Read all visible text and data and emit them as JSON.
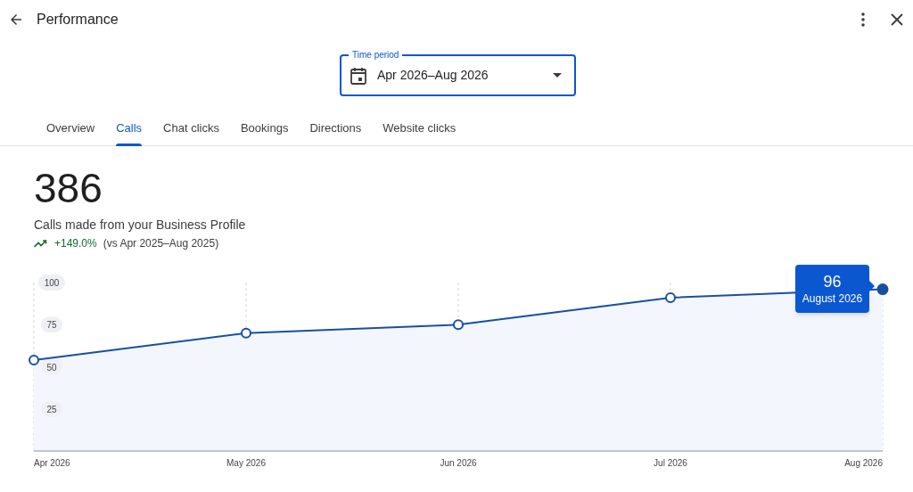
{
  "header": {
    "title": "Performance"
  },
  "time_period": {
    "label": "Time period",
    "value": "Apr 2026–Aug 2026"
  },
  "tabs": [
    {
      "label": "Overview",
      "selected": false
    },
    {
      "label": "Calls",
      "selected": true
    },
    {
      "label": "Chat clicks",
      "selected": false
    },
    {
      "label": "Bookings",
      "selected": false
    },
    {
      "label": "Directions",
      "selected": false
    },
    {
      "label": "Website clicks",
      "selected": false
    }
  ],
  "summary": {
    "value": "386",
    "description": "Calls made from your Business Profile",
    "change": "+149.0%",
    "comparison": "(vs Apr 2025–Aug 2025)"
  },
  "chart": {
    "chart_data": {
      "type": "area",
      "categories": [
        "Apr 2026",
        "May 2026",
        "Jun 2026",
        "Jul 2026",
        "Aug 2026"
      ],
      "ylim": [
        0,
        100
      ],
      "yticks": [
        25,
        50,
        75,
        100
      ],
      "grid": true,
      "series": [
        {
          "color": "#1a4fa0",
          "values": [
            54,
            70,
            75,
            91,
            96
          ]
        }
      ]
    },
    "tooltip": {
      "value": "96",
      "label": "August 2026"
    }
  }
}
